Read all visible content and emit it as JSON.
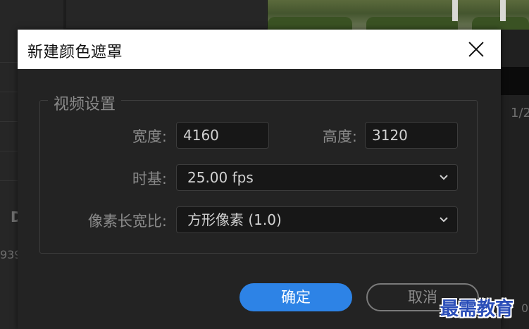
{
  "background_app": {
    "label_d": "D",
    "number_left": "939",
    "number_right": "1/2",
    "number_bottom_right": "0"
  },
  "dialog": {
    "title": "新建颜色遮罩",
    "group_title": "视频设置",
    "width_label": "宽度:",
    "width_value": "4160",
    "height_label": "高度:",
    "height_value": "3120",
    "timebase_label": "时基:",
    "timebase_value": "25.00 fps",
    "pixel_aspect_label": "像素长宽比:",
    "pixel_aspect_value": "方形像素 (1.0)",
    "ok_label": "确定",
    "cancel_label": "取消"
  },
  "watermark": "最需教育",
  "colors": {
    "primary_button": "#2d83e6",
    "dialog_bg": "#232323",
    "titlebar_bg": "#ffffff"
  }
}
